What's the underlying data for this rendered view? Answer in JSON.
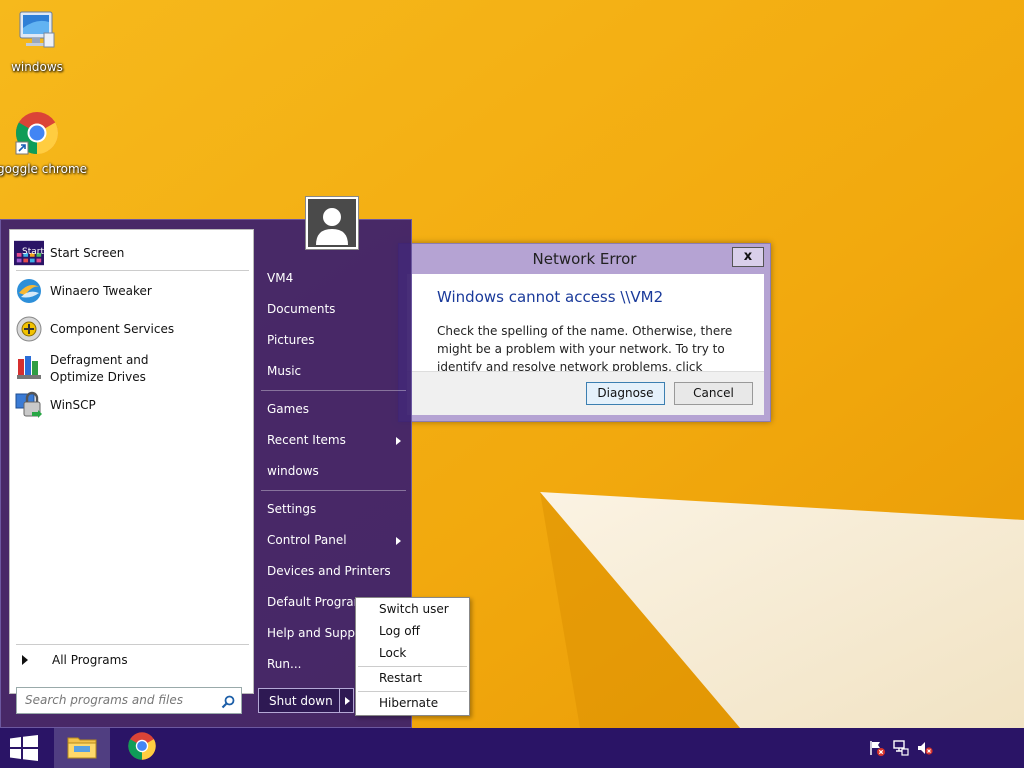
{
  "desktop": {
    "icons": [
      {
        "label": "windows",
        "icon": "computer-icon"
      },
      {
        "label": "goggle chrome",
        "icon": "chrome-icon"
      }
    ]
  },
  "dialog": {
    "title": "Network Error",
    "close_label": "x",
    "heading": "Windows cannot access \\\\VM2",
    "message": "Check the spelling of the name. Otherwise, there might be a problem with your network. To try to identify and resolve network problems, click Diagnose.",
    "diagnose_label": "Diagnose",
    "cancel_label": "Cancel"
  },
  "start_menu": {
    "left_items": [
      {
        "label": "Start Screen",
        "icon": "start-screen-icon"
      },
      {
        "label": "Winaero Tweaker",
        "icon": "winaero-tweaker-icon"
      },
      {
        "label": "Component Services",
        "icon": "component-services-icon"
      },
      {
        "label": "Defragment and Optimize Drives",
        "icon": "defragment-icon"
      },
      {
        "label": "WinSCP",
        "icon": "winscp-icon"
      }
    ],
    "start_tile_text": "Start",
    "all_programs": "All Programs",
    "search_placeholder": "Search programs and files",
    "right_items": [
      {
        "label": "VM4"
      },
      {
        "label": "Documents"
      },
      {
        "label": "Pictures"
      },
      {
        "label": "Music"
      },
      {
        "label": "Games"
      },
      {
        "label": "Recent Items",
        "submenu": true
      },
      {
        "label": "windows"
      },
      {
        "label": "Settings"
      },
      {
        "label": "Control Panel",
        "submenu": true
      },
      {
        "label": "Devices and Printers"
      },
      {
        "label": "Default Programs"
      },
      {
        "label": "Help and Support"
      },
      {
        "label": "Run..."
      }
    ],
    "shutdown_label": "Shut down"
  },
  "power_menu": {
    "items": [
      "Switch user",
      "Log off",
      "Lock",
      "Restart",
      "Hibernate"
    ]
  },
  "taskbar": {
    "pinned": [
      {
        "icon": "file-explorer-icon",
        "active": true
      },
      {
        "icon": "chrome-icon",
        "active": false
      }
    ],
    "tray_icons": [
      "action-center-flag-icon",
      "network-icon",
      "volume-muted-icon"
    ]
  },
  "colors": {
    "wallpaper": "#f2ae12",
    "start_menu_bg": "#3a1e6e",
    "taskbar_bg": "#2a1466",
    "dialog_heading": "#1a3a9a"
  }
}
